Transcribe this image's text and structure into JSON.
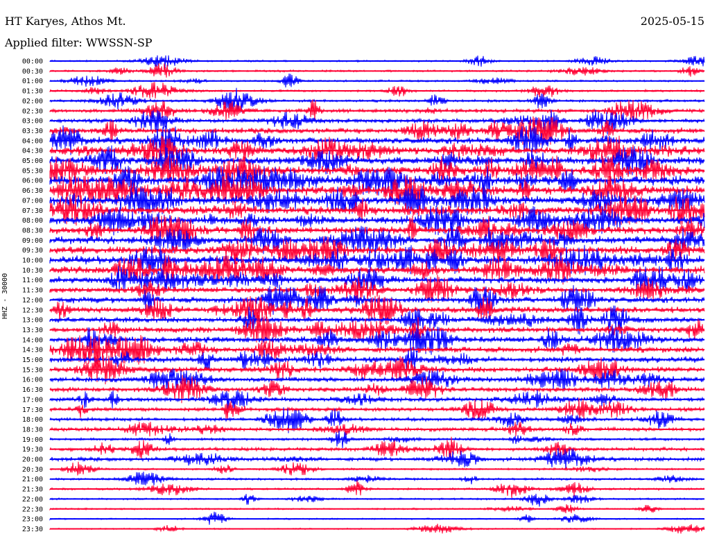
{
  "header": {
    "station": "HT Karyes, Athos Mt.",
    "date": "2025-05-15",
    "filter": "Applied filter: WWSSN-SP"
  },
  "side_label": "HHZ - 30000",
  "colors": {
    "trace_a": "#0000ff",
    "trace_b": "#ff0033",
    "background": "#ffffff"
  },
  "rows": [
    {
      "time": "00:00",
      "color": "blue",
      "level": 0.1
    },
    {
      "time": "00:30",
      "color": "red",
      "level": 0.12
    },
    {
      "time": "01:00",
      "color": "blue",
      "level": 0.12
    },
    {
      "time": "01:30",
      "color": "red",
      "level": 0.15
    },
    {
      "time": "02:00",
      "color": "blue",
      "level": 0.2
    },
    {
      "time": "02:30",
      "color": "red",
      "level": 0.35
    },
    {
      "time": "03:00",
      "color": "blue",
      "level": 0.4
    },
    {
      "time": "03:30",
      "color": "red",
      "level": 0.55
    },
    {
      "time": "04:00",
      "color": "blue",
      "level": 0.7
    },
    {
      "time": "04:30",
      "color": "red",
      "level": 0.8
    },
    {
      "time": "05:00",
      "color": "blue",
      "level": 0.85
    },
    {
      "time": "05:30",
      "color": "red",
      "level": 0.9
    },
    {
      "time": "06:00",
      "color": "blue",
      "level": 0.95
    },
    {
      "time": "06:30",
      "color": "red",
      "level": 1.0
    },
    {
      "time": "07:00",
      "color": "blue",
      "level": 0.95
    },
    {
      "time": "07:30",
      "color": "red",
      "level": 0.9
    },
    {
      "time": "08:00",
      "color": "blue",
      "level": 0.85
    },
    {
      "time": "08:30",
      "color": "red",
      "level": 0.8
    },
    {
      "time": "09:00",
      "color": "blue",
      "level": 0.8
    },
    {
      "time": "09:30",
      "color": "red",
      "level": 0.85
    },
    {
      "time": "10:00",
      "color": "blue",
      "level": 0.9
    },
    {
      "time": "10:30",
      "color": "red",
      "level": 0.8
    },
    {
      "time": "11:00",
      "color": "blue",
      "level": 0.7
    },
    {
      "time": "11:30",
      "color": "red",
      "level": 0.6
    },
    {
      "time": "12:00",
      "color": "blue",
      "level": 0.65
    },
    {
      "time": "12:30",
      "color": "red",
      "level": 0.6
    },
    {
      "time": "13:00",
      "color": "blue",
      "level": 0.55
    },
    {
      "time": "13:30",
      "color": "red",
      "level": 0.6
    },
    {
      "time": "14:00",
      "color": "blue",
      "level": 0.65
    },
    {
      "time": "14:30",
      "color": "red",
      "level": 0.6
    },
    {
      "time": "15:00",
      "color": "blue",
      "level": 0.6
    },
    {
      "time": "15:30",
      "color": "red",
      "level": 0.55
    },
    {
      "time": "16:00",
      "color": "blue",
      "level": 0.5
    },
    {
      "time": "16:30",
      "color": "red",
      "level": 0.45
    },
    {
      "time": "17:00",
      "color": "blue",
      "level": 0.4
    },
    {
      "time": "17:30",
      "color": "red",
      "level": 0.35
    },
    {
      "time": "18:00",
      "color": "blue",
      "level": 0.3
    },
    {
      "time": "18:30",
      "color": "red",
      "level": 0.35
    },
    {
      "time": "19:00",
      "color": "blue",
      "level": 0.2
    },
    {
      "time": "19:30",
      "color": "red",
      "level": 0.3
    },
    {
      "time": "20:00",
      "color": "blue",
      "level": 0.35
    },
    {
      "time": "20:30",
      "color": "red",
      "level": 0.12
    },
    {
      "time": "21:00",
      "color": "blue",
      "level": 0.15
    },
    {
      "time": "21:30",
      "color": "red",
      "level": 0.15
    },
    {
      "time": "22:00",
      "color": "blue",
      "level": 0.1
    },
    {
      "time": "22:30",
      "color": "red",
      "level": 0.08
    },
    {
      "time": "23:00",
      "color": "blue",
      "level": 0.06
    },
    {
      "time": "23:30",
      "color": "red",
      "level": 0.05
    }
  ]
}
